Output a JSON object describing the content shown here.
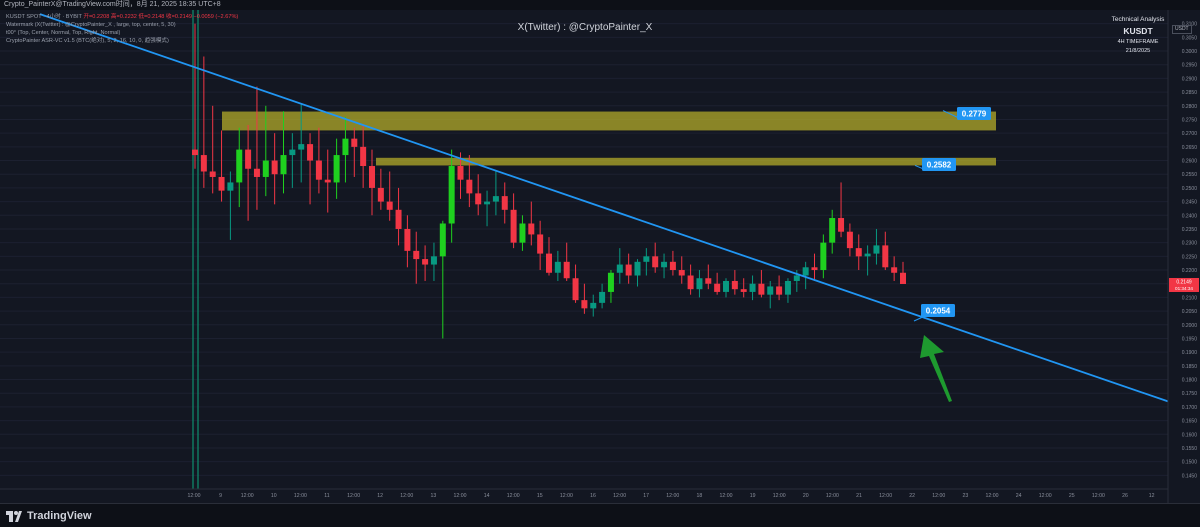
{
  "header": {
    "topbar_text": "Crypto_PainterX@TradingView.com时间，8月 21, 2025 18:35 UTC+8",
    "legend_symbol": "KUSDT SPOT · 4小时 · BYBIT",
    "legend_ohlc": "开=0.2208  高=0.2232  低=0.2148  收=0.2149  −0.0059 (−2.67%)",
    "legend_line2": "Watermark (X(Twitter) : @CryptoPainter_X , large, top, center, 5, 30)",
    "legend_line3": "t00° (Top, Center, Normal, Top, Right, Normal)",
    "legend_line4": "CryptoPainter ASR-VC v1.5 (BTC(绝对), 5, 2, 16, 10, 0, 趋强模式)"
  },
  "watermark": "X(Twitter) : @CryptoPainter_X",
  "analysis_box": {
    "line1": "Technical Analysis",
    "line2": "KUSDT",
    "line3": "4H TIMEFRAME",
    "line4": "21/8/2025"
  },
  "currency_tag": "USDT",
  "footer": {
    "brand": "TradingView"
  },
  "colors": {
    "background": "#131722",
    "up": "#089981",
    "up_bright": "#1fd01f",
    "down": "#f23645",
    "trendline": "#2196f3",
    "zone": "#b8b02a",
    "arrow": "#1e9a2f",
    "price_tag": "#2196f3",
    "last_price_tag": "#f23645"
  },
  "chart_data": {
    "type": "candlestick",
    "timeframe": "4H",
    "y_axis": {
      "ylim": [
        0.14,
        0.315
      ],
      "ticks": [
        "0.3100",
        "0.3050",
        "0.3000",
        "0.2950",
        "0.2900",
        "0.2850",
        "0.2800",
        "0.2750",
        "0.2700",
        "0.2650",
        "0.2600",
        "0.2550",
        "0.2500",
        "0.2450",
        "0.2400",
        "0.2350",
        "0.2300",
        "0.2250",
        "0.2200",
        "0.2150",
        "0.2100",
        "0.2050",
        "0.2000",
        "0.1950",
        "0.1900",
        "0.1850",
        "0.1800",
        "0.1750",
        "0.1700",
        "0.1650",
        "0.1600",
        "0.1550",
        "0.1500",
        "0.1450"
      ]
    },
    "x_axis": {
      "tick_labels": [
        "12:00",
        "9",
        "12:00",
        "10",
        "12:00",
        "11",
        "12:00",
        "12",
        "12:00",
        "13",
        "12:00",
        "14",
        "12:00",
        "15",
        "12:00",
        "16",
        "12:00",
        "17",
        "12:00",
        "18",
        "12:00",
        "19",
        "12:00",
        "20",
        "12:00",
        "21",
        "12:00",
        "22",
        "12:00",
        "23",
        "12:00",
        "24",
        "12:00",
        "25",
        "12:00",
        "26",
        "12"
      ]
    },
    "resistance_zones": [
      {
        "top": 0.2779,
        "bottom": 0.271,
        "label": "0.2779"
      },
      {
        "top": 0.261,
        "bottom": 0.2582,
        "label": "0.2582"
      }
    ],
    "trendline": {
      "label": "0.2054",
      "start": [
        0,
        0.3135
      ],
      "end": [
        38.0,
        0.172
      ]
    },
    "support_label": "0.2054",
    "last_price": {
      "value": "0.2149",
      "countdown": "01:34:34"
    },
    "candles": [
      [
        0.264,
        0.31,
        0.257,
        0.262
      ],
      [
        0.262,
        0.298,
        0.25,
        0.256
      ],
      [
        0.256,
        0.28,
        0.248,
        0.254
      ],
      [
        0.254,
        0.271,
        0.245,
        0.249
      ],
      [
        0.249,
        0.256,
        0.231,
        0.252
      ],
      [
        0.252,
        0.272,
        0.243,
        0.264
      ],
      [
        0.264,
        0.273,
        0.238,
        0.257
      ],
      [
        0.257,
        0.287,
        0.242,
        0.254
      ],
      [
        0.254,
        0.28,
        0.247,
        0.26
      ],
      [
        0.26,
        0.27,
        0.244,
        0.255
      ],
      [
        0.255,
        0.278,
        0.248,
        0.262
      ],
      [
        0.262,
        0.27,
        0.25,
        0.264
      ],
      [
        0.264,
        0.281,
        0.252,
        0.266
      ],
      [
        0.266,
        0.27,
        0.244,
        0.26
      ],
      [
        0.26,
        0.272,
        0.248,
        0.253
      ],
      [
        0.253,
        0.264,
        0.241,
        0.252
      ],
      [
        0.252,
        0.268,
        0.246,
        0.262
      ],
      [
        0.262,
        0.276,
        0.252,
        0.268
      ],
      [
        0.268,
        0.272,
        0.254,
        0.265
      ],
      [
        0.265,
        0.273,
        0.25,
        0.258
      ],
      [
        0.258,
        0.264,
        0.24,
        0.25
      ],
      [
        0.25,
        0.257,
        0.242,
        0.245
      ],
      [
        0.245,
        0.256,
        0.238,
        0.242
      ],
      [
        0.242,
        0.25,
        0.229,
        0.235
      ],
      [
        0.235,
        0.24,
        0.221,
        0.227
      ],
      [
        0.227,
        0.234,
        0.215,
        0.224
      ],
      [
        0.224,
        0.229,
        0.216,
        0.222
      ],
      [
        0.222,
        0.23,
        0.216,
        0.225
      ],
      [
        0.225,
        0.238,
        0.195,
        0.237
      ],
      [
        0.237,
        0.264,
        0.23,
        0.258
      ],
      [
        0.258,
        0.263,
        0.246,
        0.253
      ],
      [
        0.253,
        0.262,
        0.243,
        0.248
      ],
      [
        0.248,
        0.255,
        0.24,
        0.244
      ],
      [
        0.244,
        0.249,
        0.236,
        0.245
      ],
      [
        0.245,
        0.256,
        0.24,
        0.247
      ],
      [
        0.247,
        0.252,
        0.237,
        0.242
      ],
      [
        0.242,
        0.248,
        0.228,
        0.23
      ],
      [
        0.23,
        0.24,
        0.227,
        0.237
      ],
      [
        0.237,
        0.245,
        0.229,
        0.233
      ],
      [
        0.233,
        0.238,
        0.22,
        0.226
      ],
      [
        0.226,
        0.232,
        0.218,
        0.219
      ],
      [
        0.219,
        0.227,
        0.216,
        0.223
      ],
      [
        0.223,
        0.23,
        0.216,
        0.217
      ],
      [
        0.217,
        0.222,
        0.208,
        0.209
      ],
      [
        0.209,
        0.215,
        0.204,
        0.206
      ],
      [
        0.206,
        0.211,
        0.203,
        0.208
      ],
      [
        0.208,
        0.215,
        0.206,
        0.212
      ],
      [
        0.212,
        0.22,
        0.208,
        0.219
      ],
      [
        0.219,
        0.228,
        0.215,
        0.222
      ],
      [
        0.222,
        0.226,
        0.215,
        0.218
      ],
      [
        0.218,
        0.224,
        0.214,
        0.223
      ],
      [
        0.223,
        0.228,
        0.218,
        0.225
      ],
      [
        0.225,
        0.23,
        0.219,
        0.221
      ],
      [
        0.221,
        0.226,
        0.217,
        0.223
      ],
      [
        0.223,
        0.227,
        0.218,
        0.22
      ],
      [
        0.22,
        0.225,
        0.215,
        0.218
      ],
      [
        0.218,
        0.222,
        0.211,
        0.213
      ],
      [
        0.213,
        0.22,
        0.21,
        0.217
      ],
      [
        0.217,
        0.222,
        0.213,
        0.215
      ],
      [
        0.215,
        0.219,
        0.211,
        0.212
      ],
      [
        0.212,
        0.217,
        0.21,
        0.216
      ],
      [
        0.216,
        0.22,
        0.211,
        0.213
      ],
      [
        0.213,
        0.217,
        0.21,
        0.212
      ],
      [
        0.212,
        0.218,
        0.209,
        0.215
      ],
      [
        0.215,
        0.22,
        0.21,
        0.211
      ],
      [
        0.211,
        0.216,
        0.206,
        0.214
      ],
      [
        0.214,
        0.218,
        0.209,
        0.211
      ],
      [
        0.211,
        0.217,
        0.208,
        0.216
      ],
      [
        0.216,
        0.22,
        0.212,
        0.218
      ],
      [
        0.218,
        0.223,
        0.213,
        0.221
      ],
      [
        0.221,
        0.226,
        0.216,
        0.22
      ],
      [
        0.22,
        0.233,
        0.217,
        0.23
      ],
      [
        0.23,
        0.242,
        0.226,
        0.239
      ],
      [
        0.239,
        0.252,
        0.232,
        0.234
      ],
      [
        0.234,
        0.237,
        0.225,
        0.228
      ],
      [
        0.228,
        0.233,
        0.22,
        0.225
      ],
      [
        0.225,
        0.229,
        0.218,
        0.226
      ],
      [
        0.226,
        0.235,
        0.222,
        0.229
      ],
      [
        0.229,
        0.234,
        0.22,
        0.221
      ],
      [
        0.221,
        0.225,
        0.216,
        0.219
      ],
      [
        0.219,
        0.223,
        0.215,
        0.2149
      ]
    ]
  }
}
